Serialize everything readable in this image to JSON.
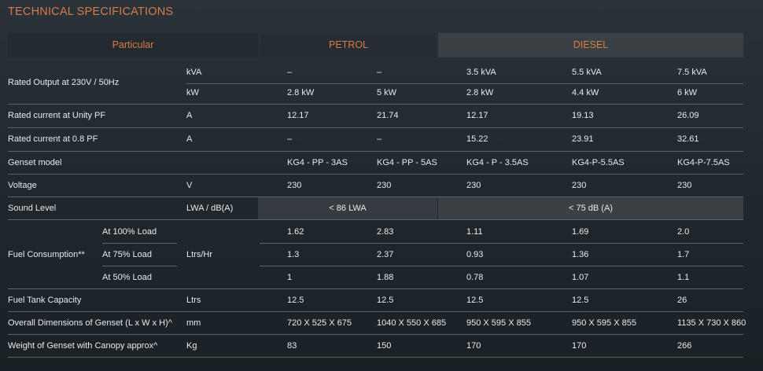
{
  "title": "TECHNICAL SPECIFICATIONS",
  "headers": {
    "particular": "Particular",
    "petrol": "PETROL",
    "diesel": "DIESEL"
  },
  "rows": {
    "rated_output": {
      "label": "Rated Output at 230V / 50Hz",
      "kva": {
        "unit": "kVA",
        "values": [
          "–",
          "–",
          "3.5 kVA",
          "5.5 kVA",
          "7.5 kVA"
        ]
      },
      "kw": {
        "unit": "kW",
        "values": [
          "2.8 kW",
          "5 kW",
          "2.8 kW",
          "4.4 kW",
          "6 kW"
        ]
      }
    },
    "current_unity": {
      "label": "Rated current at Unity PF",
      "unit": "A",
      "values": [
        "12.17",
        "21.74",
        "12.17",
        "19.13",
        "26.09"
      ]
    },
    "current_08": {
      "label": "Rated current at 0.8 PF",
      "unit": "A",
      "values": [
        "–",
        "–",
        "15.22",
        "23.91",
        "32.61"
      ]
    },
    "model": {
      "label": "Genset model",
      "unit": "",
      "values": [
        "KG4 - PP - 3AS",
        "KG4 - PP - 5AS",
        "KG4 - P - 3.5AS",
        "KG4-P-5.5AS",
        "KG4-P-7.5AS"
      ]
    },
    "voltage": {
      "label": "Voltage",
      "unit": "V",
      "values": [
        "230",
        "230",
        "230",
        "230",
        "230"
      ]
    },
    "sound": {
      "label": "Sound Level",
      "unit": "LWA / dB(A)",
      "petrol": "< 86 LWA",
      "diesel": "< 75 dB (A)"
    },
    "fuel": {
      "label": "Fuel Consumption**",
      "unit": "Ltrs/Hr",
      "sub": [
        {
          "label": "At 100% Load",
          "values": [
            "1.62",
            "2.83",
            "1.11",
            "1.69",
            "2.0"
          ]
        },
        {
          "label": "At 75% Load",
          "values": [
            "1.3",
            "2.37",
            "0.93",
            "1.36",
            "1.7"
          ]
        },
        {
          "label": "At 50% Load",
          "values": [
            "1",
            "1.88",
            "0.78",
            "1.07",
            "1.1"
          ]
        }
      ]
    },
    "tank": {
      "label": "Fuel Tank Capacity",
      "unit": "Ltrs",
      "values": [
        "12.5",
        "12.5",
        "12.5",
        "12.5",
        "26"
      ]
    },
    "dimensions": {
      "label": "Overall Dimensions of Genset (L x W x H)^",
      "unit": "mm",
      "values": [
        "720 X 525 X 675",
        "1040 X 550 X 685",
        "950 X 595 X 855",
        "950 X 595 X 855",
        "1135 X 730 X 860"
      ]
    },
    "weight": {
      "label": "Weight of Genset with Canopy approx^",
      "unit": "Kg",
      "values": [
        "83",
        "150",
        "170",
        "170",
        "266"
      ]
    }
  }
}
